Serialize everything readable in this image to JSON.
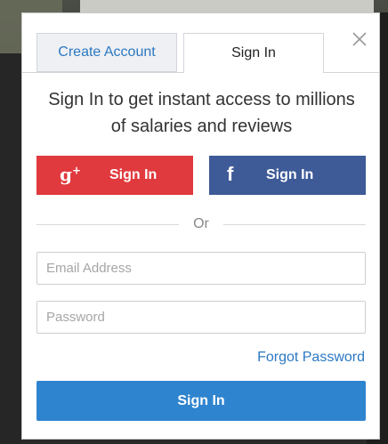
{
  "tabs": {
    "create_account": "Create Account",
    "sign_in": "Sign In"
  },
  "headline": "Sign In to get instant access to millions of salaries and reviews",
  "social": {
    "google": {
      "icon": "google-plus-icon",
      "glyph": "g+",
      "label": "Sign In",
      "color": "#e03a3e"
    },
    "facebook": {
      "icon": "facebook-icon",
      "glyph": "f",
      "label": "Sign In",
      "color": "#3e5b98"
    }
  },
  "divider_text": "Or",
  "form": {
    "email_placeholder": "Email Address",
    "email_value": "",
    "password_placeholder": "Password",
    "password_value": "",
    "forgot_password": "Forgot Password",
    "submit_label": "Sign In"
  },
  "colors": {
    "accent": "#2f84cf",
    "link": "#2b78c2",
    "google": "#e03a3e",
    "facebook": "#3e5b98"
  }
}
